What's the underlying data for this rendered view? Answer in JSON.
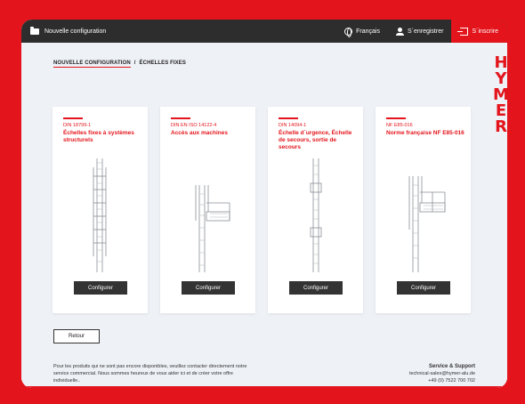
{
  "topbar": {
    "title": "Nouvelle configuration",
    "language": "Français",
    "register": "S´enregistrer",
    "signup": "S´inscrire"
  },
  "breadcrumb": {
    "home": "NOUVELLE CONFIGURATION",
    "separator": "/",
    "current": "ÉCHELLES FIXES"
  },
  "brand": {
    "letters": [
      "H",
      "Y",
      "M",
      "E",
      "R"
    ]
  },
  "cards": [
    {
      "norm": "DIN 18799-1",
      "title": "Échelles fixes à systèmes structurels",
      "button": "Configurer"
    },
    {
      "norm": "DIN EN ISO 14122-4",
      "title": "Accès aux machines",
      "button": "Configurer"
    },
    {
      "norm": "DIN 14094-1",
      "title": "Échelle d´urgence, Échelle de secours, sortie de secours",
      "button": "Configurer"
    },
    {
      "norm": "NF E85-016",
      "title": "Norme française NF E85-016",
      "button": "Configurer"
    }
  ],
  "back_button": "Retour",
  "note": "Pour les produits qui ne sont pas encore disponibles, veuillez contacter directement notre service commercial. Nous sommes heureux de vous aider ici et de créer votre offre individuelle..",
  "support": {
    "title": "Service & Support",
    "email": "technical-sales@hymer-alu.de",
    "phone": "+49 (0) 7522 700 702"
  },
  "colors": {
    "brand_red": "#e3141b",
    "topbar": "#2d2d2d",
    "background": "#eef1f6"
  },
  "icons": [
    "folder-icon",
    "globe-icon",
    "user-icon",
    "login-icon"
  ]
}
